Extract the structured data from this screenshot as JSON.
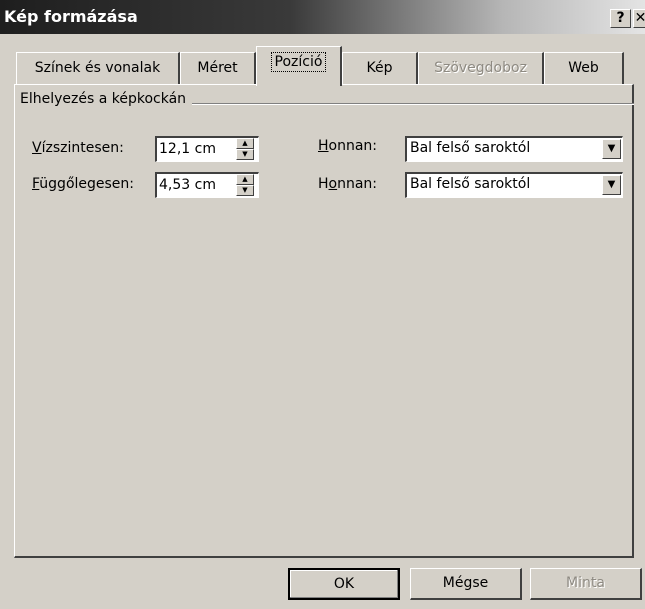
{
  "window": {
    "title": "Kép formázása",
    "help_label": "?",
    "close_label": "✕"
  },
  "tabs": [
    {
      "label": "Színek és vonalak",
      "state": "normal"
    },
    {
      "label": "Méret",
      "state": "normal"
    },
    {
      "label": "Pozíció",
      "state": "active"
    },
    {
      "label": "Kép",
      "state": "normal"
    },
    {
      "label": "Szövegdoboz",
      "state": "disabled"
    },
    {
      "label": "Web",
      "state": "normal"
    }
  ],
  "group": {
    "label": "Elhelyezés a képkockán"
  },
  "horizontal": {
    "label_mnemonic": "V",
    "label_rest": "ízszintesen:",
    "value": "12,1 cm",
    "from_mnemonic": "H",
    "from_rest": "onnan:",
    "from_value": "Bal felső saroktól"
  },
  "vertical": {
    "label_mnemonic": "F",
    "label_rest": "üggőlegesen:",
    "value": "4,53 cm",
    "from_pre": "H",
    "from_mnemonic": "o",
    "from_rest": "nnan:",
    "from_value": "Bal felső saroktól"
  },
  "buttons": {
    "ok": "OK",
    "cancel": "Mégse",
    "preview": "Minta"
  }
}
